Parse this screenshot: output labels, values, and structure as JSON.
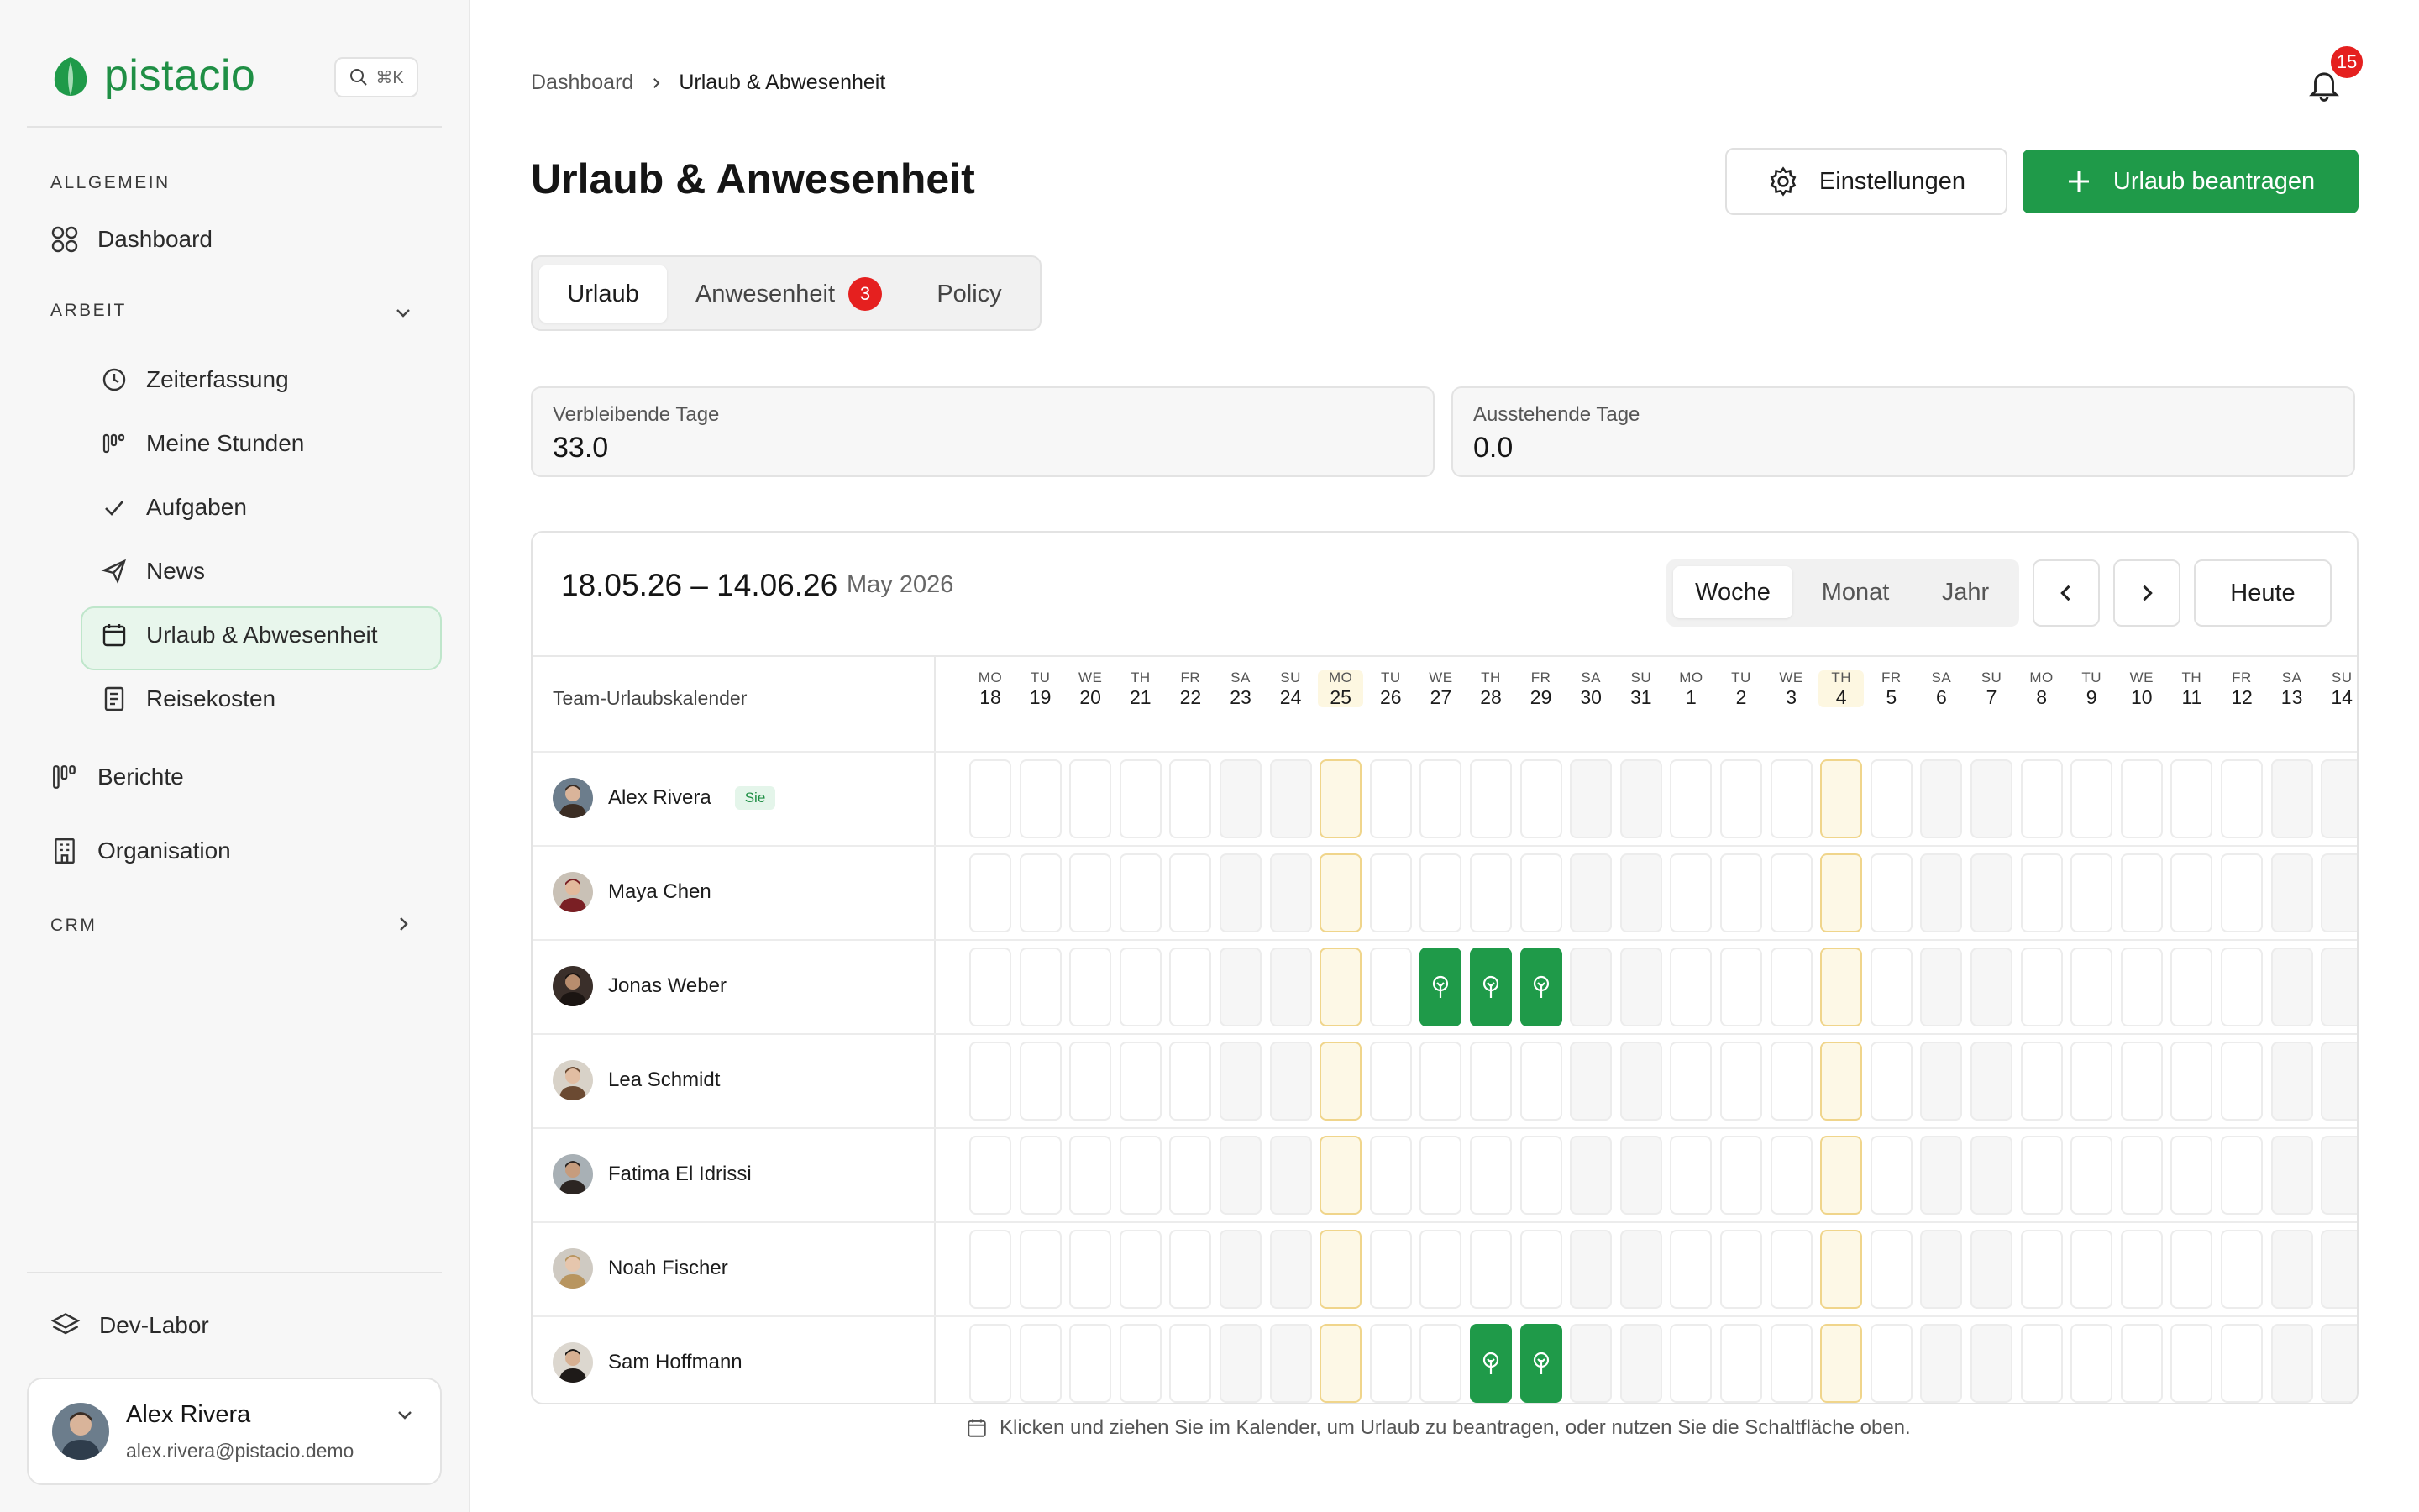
{
  "brand": {
    "name": "pistacio",
    "color": "#1f9a49",
    "search_shortcut": "⌘K"
  },
  "sidebar": {
    "section_general": "ALLGEMEIN",
    "dashboard": "Dashboard",
    "section_work": "ARBEIT",
    "work_items": [
      {
        "label": "Zeiterfassung",
        "icon": "clock-icon"
      },
      {
        "label": "Meine Stunden",
        "icon": "bars-icon"
      },
      {
        "label": "Aufgaben",
        "icon": "check-icon"
      },
      {
        "label": "News",
        "icon": "send-icon"
      },
      {
        "label": "Urlaub & Abwesenheit",
        "icon": "calendar-icon",
        "active": true
      },
      {
        "label": "Reisekosten",
        "icon": "receipt-icon"
      }
    ],
    "reports": "Berichte",
    "organisation": "Organisation",
    "section_crm": "CRM",
    "dev_lab": "Dev-Labor",
    "user": {
      "name": "Alex Rivera",
      "email": "alex.rivera@pistacio.demo"
    }
  },
  "header": {
    "breadcrumb": [
      "Dashboard",
      "Urlaub & Abwesenheit"
    ],
    "notifications": "15",
    "title": "Urlaub & Anwesenheit",
    "settings_label": "Einstellungen",
    "request_label": "Urlaub beantragen"
  },
  "tabs": [
    {
      "label": "Urlaub",
      "active": true
    },
    {
      "label": "Anwesenheit",
      "badge": "3"
    },
    {
      "label": "Policy"
    }
  ],
  "stats": [
    {
      "label": "Verbleibende Tage",
      "value": "33.0"
    },
    {
      "label": "Ausstehende Tage",
      "value": "0.0"
    }
  ],
  "calendar": {
    "range": "18.05.26 – 14.06.26",
    "month": "May 2026",
    "views": [
      {
        "label": "Woche",
        "active": true
      },
      {
        "label": "Monat"
      },
      {
        "label": "Jahr"
      }
    ],
    "today_label": "Heute",
    "team_label": "Team-Urlaubskalender",
    "days": [
      {
        "w": "MO",
        "d": "18"
      },
      {
        "w": "TU",
        "d": "19"
      },
      {
        "w": "WE",
        "d": "20"
      },
      {
        "w": "TH",
        "d": "21"
      },
      {
        "w": "FR",
        "d": "22"
      },
      {
        "w": "SA",
        "d": "23",
        "weekend": true
      },
      {
        "w": "SU",
        "d": "24",
        "weekend": true
      },
      {
        "w": "MO",
        "d": "25",
        "holiday": true
      },
      {
        "w": "TU",
        "d": "26"
      },
      {
        "w": "WE",
        "d": "27"
      },
      {
        "w": "TH",
        "d": "28"
      },
      {
        "w": "FR",
        "d": "29"
      },
      {
        "w": "SA",
        "d": "30",
        "weekend": true
      },
      {
        "w": "SU",
        "d": "31",
        "weekend": true
      },
      {
        "w": "MO",
        "d": "1"
      },
      {
        "w": "TU",
        "d": "2"
      },
      {
        "w": "WE",
        "d": "3"
      },
      {
        "w": "TH",
        "d": "4",
        "holiday": true
      },
      {
        "w": "FR",
        "d": "5"
      },
      {
        "w": "SA",
        "d": "6",
        "weekend": true
      },
      {
        "w": "SU",
        "d": "7",
        "weekend": true
      },
      {
        "w": "MO",
        "d": "8"
      },
      {
        "w": "TU",
        "d": "9"
      },
      {
        "w": "WE",
        "d": "10"
      },
      {
        "w": "TH",
        "d": "11"
      },
      {
        "w": "FR",
        "d": "12"
      },
      {
        "w": "SA",
        "d": "13",
        "weekend": true
      },
      {
        "w": "SU",
        "d": "14",
        "weekend": true
      }
    ],
    "people": [
      {
        "name": "Alex Rivera",
        "tag": "Sie",
        "vacation": []
      },
      {
        "name": "Maya Chen",
        "vacation": []
      },
      {
        "name": "Jonas Weber",
        "vacation": [
          9,
          10,
          11
        ]
      },
      {
        "name": "Lea Schmidt",
        "vacation": []
      },
      {
        "name": "Fatima El Idrissi",
        "vacation": []
      },
      {
        "name": "Noah Fischer",
        "vacation": []
      },
      {
        "name": "Sam Hoffmann",
        "vacation": [
          10,
          11
        ]
      }
    ],
    "colors": {
      "weekend": "#f6f6f6",
      "holiday": "#fdf8e6",
      "vacation": "#1f9a49"
    }
  },
  "hint": "Klicken und ziehen Sie im Kalender, um Urlaub zu beantragen, oder nutzen Sie die Schaltfläche oben."
}
